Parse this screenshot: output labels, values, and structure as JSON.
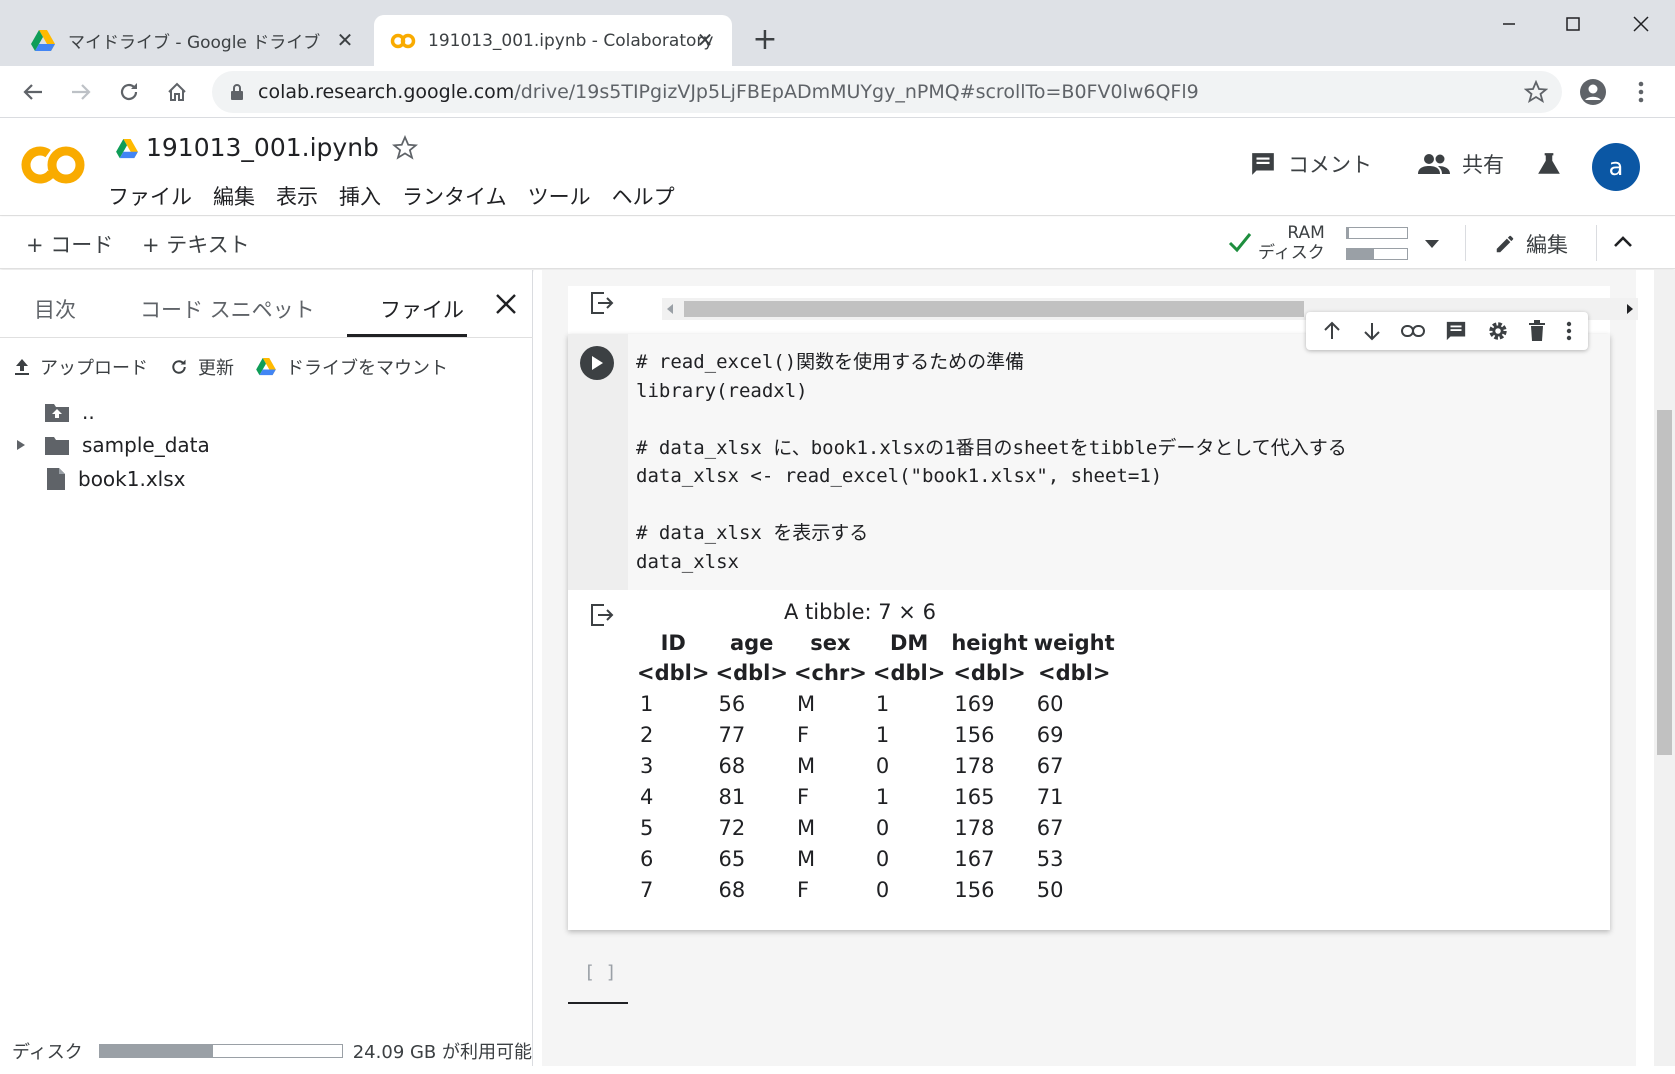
{
  "browser": {
    "tabs": [
      {
        "title": "マイドライブ - Google ドライブ",
        "icon": "google-drive-icon",
        "active": false
      },
      {
        "title": "191013_001.ipynb - Colaboratory",
        "icon": "colab-icon",
        "active": true
      }
    ],
    "new_tab_label": "+",
    "url_host": "colab.research.google.com",
    "url_path": "/drive/19s5TIPgizVJp5LjFBEpADmMUYgy_nPMQ#scrollTo=B0FV0lw6QFl9"
  },
  "colab": {
    "logo_text": "CO",
    "notebook_title": "191013_001.ipynb",
    "menu": [
      "ファイル",
      "編集",
      "表示",
      "挿入",
      "ランタイム",
      "ツール",
      "ヘルプ"
    ],
    "comment_label": "コメント",
    "share_label": "共有",
    "avatar_letter": "a"
  },
  "toolbar": {
    "add_code": "+ コード",
    "add_text": "+ テキスト",
    "ram_label": "RAM",
    "disk_label": "ディスク",
    "ram_usage": 0.03,
    "disk_usage": 0.45,
    "edit_label": "編集"
  },
  "sidepanel": {
    "tabs": [
      "目次",
      "コード スニペット",
      "ファイル"
    ],
    "active_tab": "ファイル",
    "actions": [
      "アップロード",
      "更新",
      "ドライブをマウント"
    ],
    "tree": [
      {
        "name": "..",
        "type": "parent-folder"
      },
      {
        "name": "sample_data",
        "type": "folder"
      },
      {
        "name": "book1.xlsx",
        "type": "file"
      }
    ],
    "disk_label": "ディスク",
    "disk_free": "24.09 GB が利用可能",
    "disk_usage": 0.47
  },
  "cell": {
    "code_lines": [
      "# read_excel()関数を使用するための準備",
      "library(readxl)",
      "",
      "# data_xlsx に、book1.xlsxの1番目のsheetをtibbleデータとして代入する",
      "data_xlsx <- read_excel(\"book1.xlsx\", sheet=1)",
      "",
      "# data_xlsx を表示する",
      "data_xlsx"
    ],
    "empty_cell_prompt": "[ ]"
  },
  "tibble": {
    "caption": "A tibble: 7 × 6",
    "columns": [
      "ID",
      "age",
      "sex",
      "DM",
      "height",
      "weight"
    ],
    "types": [
      "<dbl>",
      "<dbl>",
      "<chr>",
      "<dbl>",
      "<dbl>",
      "<dbl>"
    ],
    "rows": [
      [
        "1",
        "56",
        "M",
        "1",
        "169",
        "60"
      ],
      [
        "2",
        "77",
        "F",
        "1",
        "156",
        "69"
      ],
      [
        "3",
        "68",
        "M",
        "0",
        "178",
        "67"
      ],
      [
        "4",
        "81",
        "F",
        "1",
        "165",
        "71"
      ],
      [
        "5",
        "72",
        "M",
        "0",
        "178",
        "67"
      ],
      [
        "6",
        "65",
        "M",
        "0",
        "167",
        "53"
      ],
      [
        "7",
        "68",
        "F",
        "0",
        "156",
        "50"
      ]
    ]
  },
  "colors": {
    "colab_orange": "#f9ab00",
    "colab_yellow": "#ffca28",
    "avatar_blue": "#0b57a4",
    "check_green": "#1e8e3e"
  }
}
